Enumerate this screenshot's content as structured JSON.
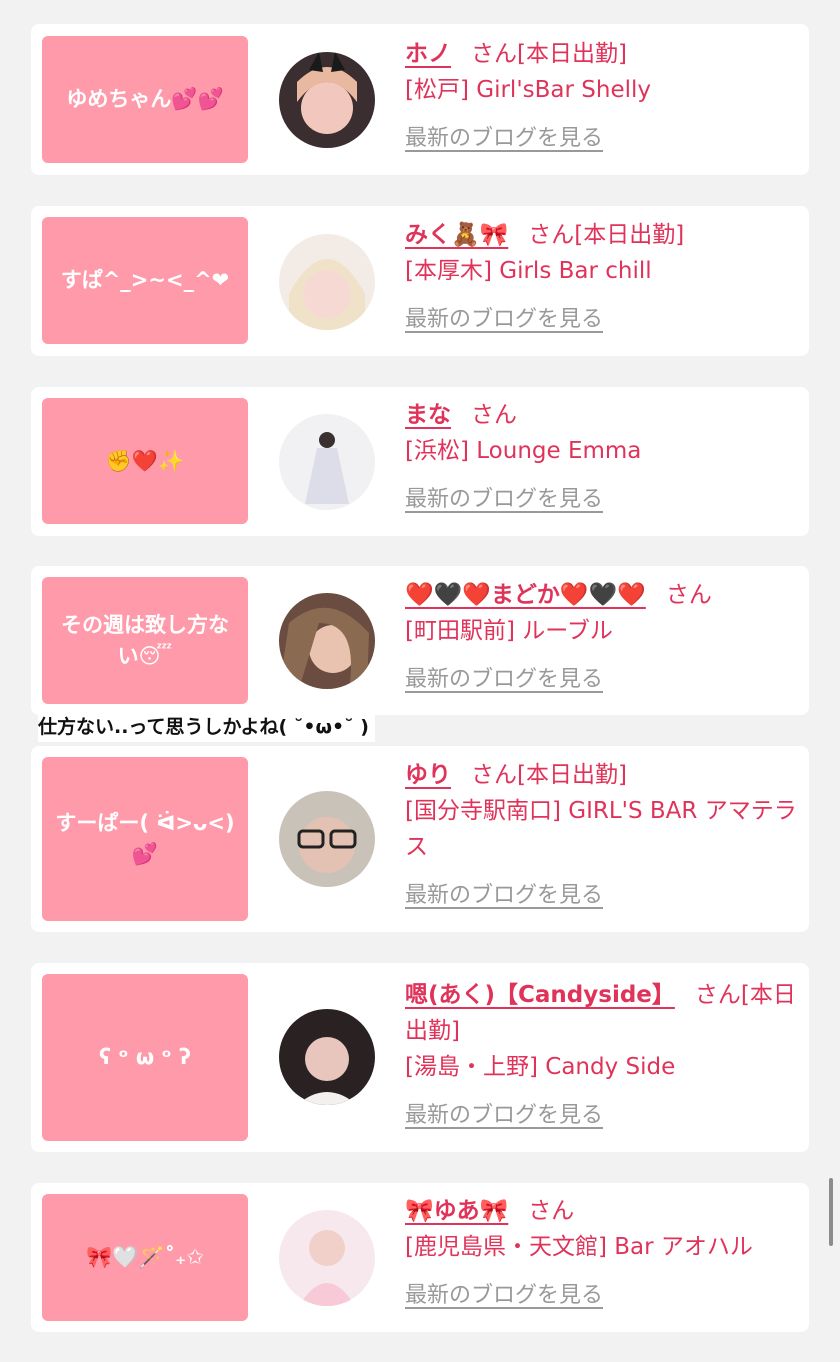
{
  "colors": {
    "accent": "#e0335a",
    "bubble": "#ff9aaa",
    "link_gray": "#999999",
    "background": "#f2f2f2"
  },
  "overlay_text": "仕方ない..って思うしかよね( ˘•ω•˘ )",
  "cards": [
    {
      "bubble": "ゆめちゃん💕💕",
      "name": "ホノ",
      "san": "さん[本日出勤]",
      "shop": "[松戸] Girl'sBar Shelly",
      "blog": "最新のブログを見る"
    },
    {
      "bubble": "すぱ^_>~<_^❤",
      "name": "みく🧸🎀",
      "san": "さん[本日出勤]",
      "shop": "[本厚木] Girls Bar chill",
      "blog": "最新のブログを見る"
    },
    {
      "bubble": "✊❤️✨",
      "name": "まな",
      "san": "さん",
      "shop": "[浜松] Lounge Emma",
      "blog": "最新のブログを見る"
    },
    {
      "bubble": "その週は致し方ない😴",
      "name": "❤️🖤❤️まどか❤️🖤❤️",
      "san": "さん",
      "shop": "[町田駅前] ルーブル",
      "blog": "最新のブログを見る"
    },
    {
      "bubble": "すーぱー( ᐛ>ᴗ<)💕",
      "name": "ゆり",
      "san": "さん[本日出勤]",
      "shop": "[国分寺駅南口] GIRL'S BAR アマテラス",
      "blog": "最新のブログを見る"
    },
    {
      "bubble": "ʕ ᵒ ω ᵒ ʔ",
      "name": "嗯(あく)【Candyside】",
      "san": "さん[本日出勤]",
      "shop": "[湯島・上野] Candy Side",
      "blog": "最新のブログを見る"
    },
    {
      "bubble": "🎀🤍🪄˚₊✩",
      "name": "🎀ゆあ🎀",
      "san": "さん",
      "shop": "[鹿児島県・天文館] Bar アオハル",
      "blog": "最新のブログを見る"
    }
  ]
}
